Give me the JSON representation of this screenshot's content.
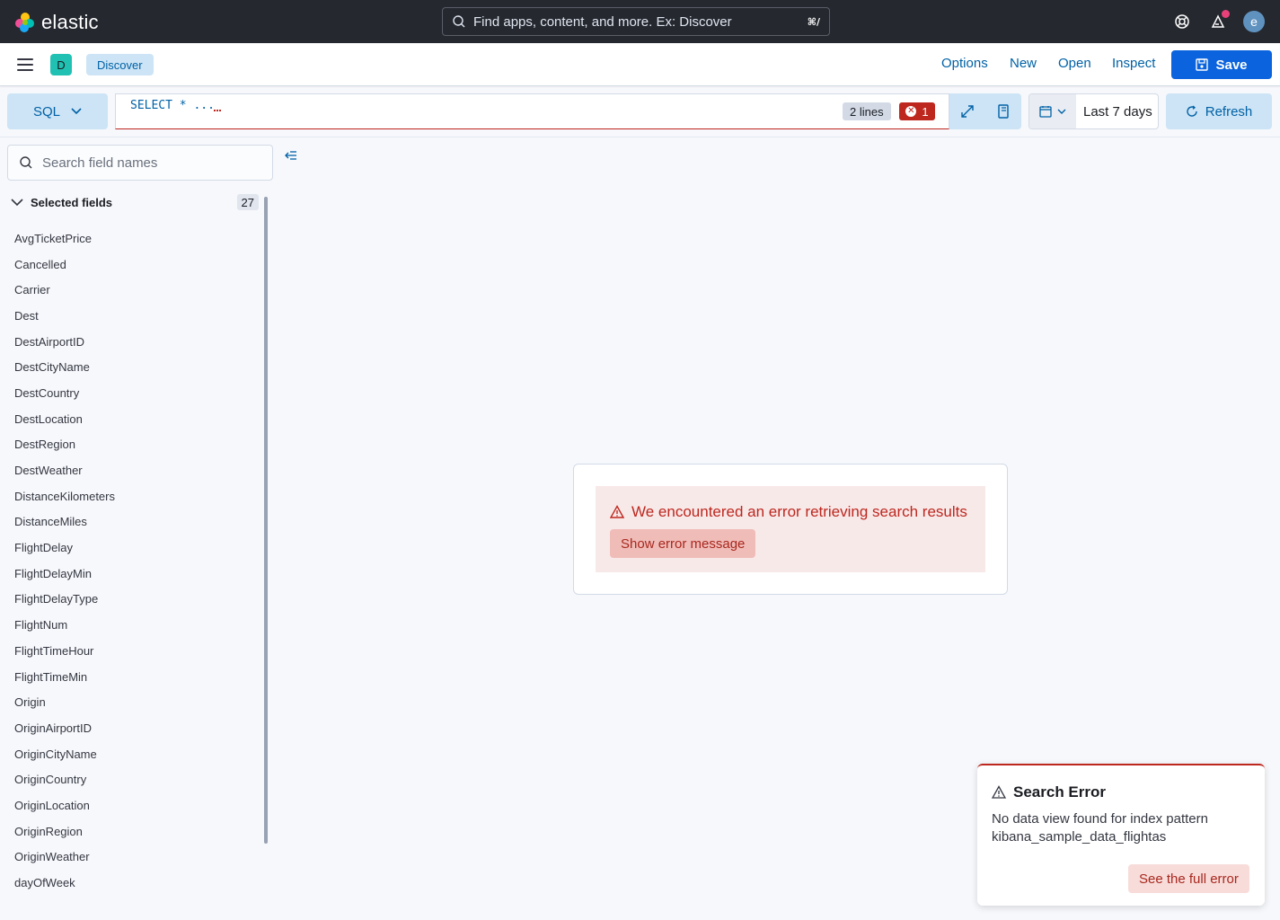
{
  "header": {
    "brand": "elastic",
    "search_placeholder": "Find apps, content, and more. Ex: Discover",
    "shortcut": "⌘/",
    "avatar_initial": "e"
  },
  "appbar": {
    "space_initial": "D",
    "breadcrumb": "Discover",
    "links": {
      "options": "Options",
      "new": "New",
      "open": "Open",
      "inspect": "Inspect"
    },
    "save_label": "Save"
  },
  "query": {
    "language": "SQL",
    "code": "SELECT * ...",
    "lines_badge": "2 lines",
    "error_count": "1",
    "date_range": "Last 7 days",
    "refresh_label": "Refresh"
  },
  "sidebar": {
    "search_placeholder": "Search field names",
    "section_title": "Selected fields",
    "section_count": "27",
    "fields": [
      "AvgTicketPrice",
      "Cancelled",
      "Carrier",
      "Dest",
      "DestAirportID",
      "DestCityName",
      "DestCountry",
      "DestLocation",
      "DestRegion",
      "DestWeather",
      "DistanceKilometers",
      "DistanceMiles",
      "FlightDelay",
      "FlightDelayMin",
      "FlightDelayType",
      "FlightNum",
      "FlightTimeHour",
      "FlightTimeMin",
      "Origin",
      "OriginAirportID",
      "OriginCityName",
      "OriginCountry",
      "OriginLocation",
      "OriginRegion",
      "OriginWeather",
      "dayOfWeek"
    ]
  },
  "error_panel": {
    "title": "We encountered an error retrieving search results",
    "button": "Show error message"
  },
  "toast": {
    "title": "Search Error",
    "body": "No data view found for index pattern kibana_sample_data_flightas",
    "button": "See the full error"
  },
  "colors": {
    "primary": "#0b64dd",
    "danger": "#bd271e",
    "header_bg": "#25282f"
  }
}
